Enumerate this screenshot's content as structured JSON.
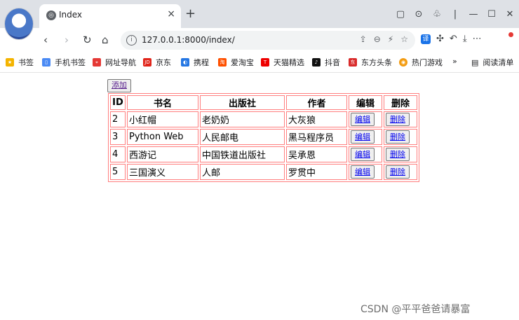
{
  "browser": {
    "tab_title": "Index",
    "tab_close": "×",
    "new_tab": "+",
    "url": "127.0.0.1:8000/index/",
    "translate_label": "译",
    "bookmarks": [
      {
        "label": "书签",
        "icon": "star-icon",
        "color": "#f4b400"
      },
      {
        "label": "手机书签",
        "icon": "phone-icon",
        "color": "#4a8af4"
      },
      {
        "label": "网址导航",
        "icon": "navigation-icon",
        "color": "#e53935"
      },
      {
        "label": "京东",
        "icon": "jd-icon",
        "color": "#e1251b"
      },
      {
        "label": "携程",
        "icon": "ctrip-icon",
        "color": "#2577e3"
      },
      {
        "label": "爱淘宝",
        "icon": "taobao-icon",
        "color": "#ff5000"
      },
      {
        "label": "天猫精选",
        "icon": "tmall-icon",
        "color": "#e00"
      },
      {
        "label": "抖音",
        "icon": "douyin-icon",
        "color": "#111"
      },
      {
        "label": "东方头条",
        "icon": "toutiao-icon",
        "color": "#d92b2b"
      },
      {
        "label": "热门游戏",
        "icon": "game-icon",
        "color": "#f39c12"
      }
    ],
    "more_bookmarks": "»",
    "reading_list": "阅读清单"
  },
  "page": {
    "add_label": "添加",
    "headers": [
      "ID",
      "书名",
      "出版社",
      "作者",
      "编辑",
      "删除"
    ],
    "rows": [
      {
        "id": "2",
        "name": "小红帽",
        "publisher": "老奶奶",
        "author": "大灰狼"
      },
      {
        "id": "3",
        "name": "Python Web",
        "publisher": "人民邮电",
        "author": "黑马程序员"
      },
      {
        "id": "4",
        "name": "西游记",
        "publisher": "中国铁道出版社",
        "author": "吴承恩"
      },
      {
        "id": "5",
        "name": "三国演义",
        "publisher": "人邮",
        "author": "罗贯中"
      }
    ],
    "edit_label": "编辑",
    "delete_label": "删除"
  },
  "watermark": "CSDN @平平爸爸请暴富"
}
